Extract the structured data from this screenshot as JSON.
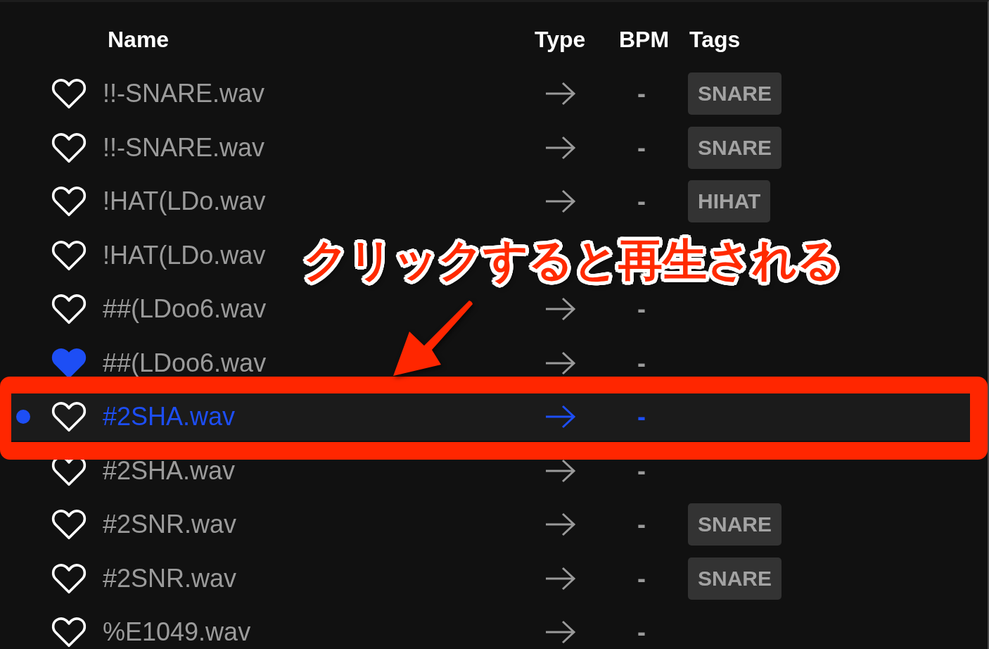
{
  "columns": [
    {
      "label": "Name"
    },
    {
      "label": "Type"
    },
    {
      "label": "BPM"
    },
    {
      "label": "Tags"
    }
  ],
  "rows": [
    {
      "name": "!!-SNARE.wav",
      "favorite": false,
      "selected": false,
      "bpm": "-",
      "tags": [
        "SNARE"
      ]
    },
    {
      "name": "!!-SNARE.wav",
      "favorite": false,
      "selected": false,
      "bpm": "-",
      "tags": [
        "SNARE"
      ]
    },
    {
      "name": "!HAT(LDo.wav",
      "favorite": false,
      "selected": false,
      "bpm": "-",
      "tags": [
        "HIHAT"
      ]
    },
    {
      "name": "!HAT(LDo.wav",
      "favorite": false,
      "selected": false
    },
    {
      "name": "##(LDoo6.wav",
      "favorite": false,
      "selected": false,
      "bpm": "-"
    },
    {
      "name": "##(LDoo6.wav",
      "favorite": true,
      "selected": false,
      "bpm": "-"
    },
    {
      "name": "#2SHA.wav",
      "favorite": false,
      "selected": true,
      "bpm": "-"
    },
    {
      "name": "#2SHA.wav",
      "favorite": false,
      "selected": false,
      "bpm": "-"
    },
    {
      "name": "#2SNR.wav",
      "favorite": false,
      "selected": false,
      "bpm": "-",
      "tags": [
        "SNARE"
      ]
    },
    {
      "name": "#2SNR.wav",
      "favorite": false,
      "selected": false,
      "bpm": "-",
      "tags": [
        "SNARE"
      ]
    },
    {
      "name": "%E1049.wav",
      "favorite": false,
      "selected": false,
      "bpm": "-"
    }
  ],
  "annotation": {
    "text": "クリックすると再生される"
  }
}
